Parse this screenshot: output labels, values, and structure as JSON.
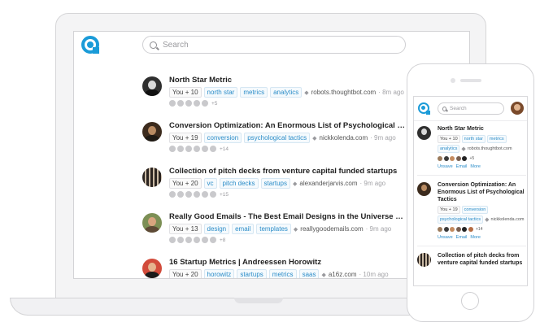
{
  "desktop": {
    "search": {
      "placeholder": "Search"
    },
    "feed": [
      {
        "title": "North Star Metric",
        "you": "You + 10",
        "tags": [
          "north star",
          "metrics",
          "analytics"
        ],
        "domain": "robots.thoughtbot.com",
        "ago": "· 8m ago",
        "more": "+5",
        "faces": 5,
        "avatar": "bw-portrait"
      },
      {
        "title": "Conversion Optimization: An Enormous List of Psychological Tactics",
        "you": "You + 19",
        "tags": [
          "conversion",
          "psychological tactics"
        ],
        "domain": "nickkolenda.com",
        "ago": "· 9m ago",
        "more": "+14",
        "faces": 6,
        "avatar": "color-portrait"
      },
      {
        "title": "Collection of pitch decks from venture capital funded startups",
        "you": "You + 20",
        "tags": [
          "vc",
          "pitch decks",
          "startups"
        ],
        "domain": "alexanderjarvis.com",
        "ago": "· 9m ago",
        "more": "+15",
        "faces": 6,
        "avatar": "stripes"
      },
      {
        "title": "Really Good Emails - The Best Email Designs in the Universe (that we've seen)",
        "you": "You + 13",
        "tags": [
          "design",
          "email",
          "templates"
        ],
        "domain": "reallygoodemails.com",
        "ago": "· 9m ago",
        "more": "+8",
        "faces": 6,
        "avatar": "green-portrait"
      },
      {
        "title": "16 Startup Metrics | Andreessen Horowitz",
        "you": "You + 20",
        "tags": [
          "horowitz",
          "startups",
          "metrics",
          "saas"
        ],
        "domain": "a16z.com",
        "ago": "· 10m ago",
        "more": "",
        "faces": 0,
        "avatar": "red-portrait"
      }
    ]
  },
  "mobile": {
    "search": {
      "placeholder": "Search"
    },
    "actions": [
      "Unsave",
      "Email",
      "More"
    ],
    "feed": [
      {
        "title": "North Star Metric",
        "you": "You + 10",
        "tags": [
          "north star",
          "metrics",
          "analytics"
        ],
        "domain": "robots.thoughtbot.com",
        "more": "+5",
        "faces": 5,
        "avatar": "bw-portrait"
      },
      {
        "title": "Conversion Optimization: An Enormous List of Psychological Tactics",
        "you": "You + 19",
        "tags": [
          "conversion",
          "psychological tactics"
        ],
        "domain": "nickkolenda.com",
        "more": "+14",
        "faces": 6,
        "avatar": "color-portrait"
      },
      {
        "title": "Collection of pitch decks from venture capital funded startups",
        "avatar": "stripes"
      }
    ]
  },
  "colors": {
    "accent": "#1a9bd8",
    "link": "#2a8cc8",
    "meta": "#a3a3a7"
  }
}
